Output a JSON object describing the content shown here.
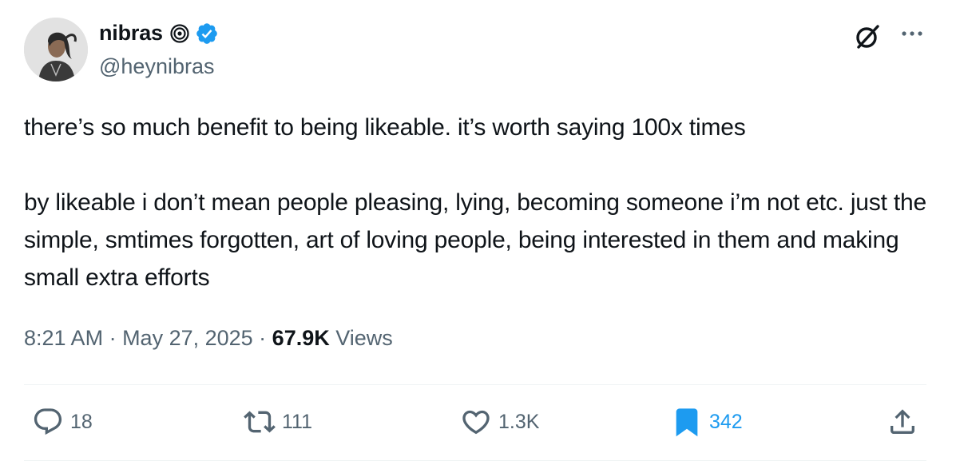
{
  "author": {
    "display_name": "nibras",
    "handle": "@heynibras",
    "verified": true,
    "avatar_icon": "avatar-photo"
  },
  "tweet": {
    "text": "there’s so much benefit to being likeable. it’s worth saying 100x times\n\nby likeable i don’t mean people pleasing, lying, becoming someone i’m not etc. just the simple, smtimes forgotten, art of loving people, being interested in them and making small extra efforts",
    "time": "8:21 AM",
    "date": "May 27, 2025",
    "views_count": "67.9K",
    "views_label": "Views"
  },
  "actions": {
    "replies": "18",
    "reposts": "111",
    "likes": "1.3K",
    "bookmarks": "342"
  },
  "icons": {
    "badge": "spiral-icon",
    "verified": "verified-badge-icon",
    "grok": "grok-icon",
    "more": "more-icon",
    "reply": "reply-icon",
    "repost": "repost-icon",
    "like": "heart-icon",
    "bookmark": "bookmark-icon",
    "share": "share-icon"
  },
  "colors": {
    "text": "#0f1419",
    "secondary": "#536471",
    "accent": "#1d9bf0",
    "divider": "#eff3f4"
  }
}
